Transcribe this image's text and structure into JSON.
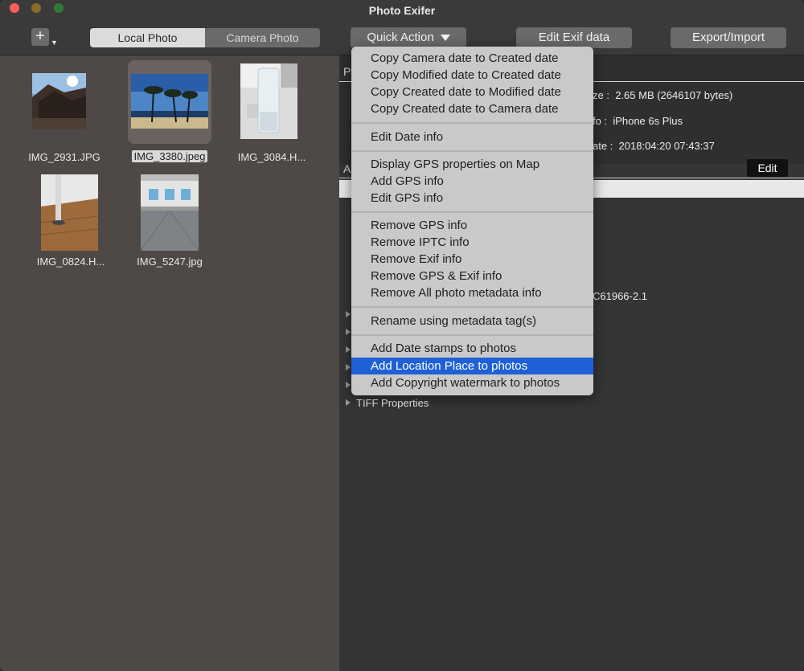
{
  "window": {
    "title": "Photo Exifer"
  },
  "toolbar": {
    "add_symbol": "+",
    "segments": [
      "Local Photo",
      "Camera Photo"
    ],
    "quick_action": "Quick Action",
    "edit_exif": "Edit Exif data",
    "export_import": "Export/Import"
  },
  "photos": [
    {
      "name": "IMG_2931.JPG"
    },
    {
      "name": "IMG_3380.jpeg",
      "selected": true
    },
    {
      "name": "IMG_3084.H..."
    },
    {
      "name": "IMG_0824.H..."
    },
    {
      "name": "IMG_5247.jpg"
    }
  ],
  "right": {
    "tab1_initial": "P",
    "tab2_initial": "A",
    "rows": [
      {
        "label": "ze :",
        "value": "2.65 MB (2646107 bytes)"
      },
      {
        "label": "fo :",
        "value": "iPhone 6s Plus"
      },
      {
        "label": "ate :",
        "value": "2018:04:20 07:43:37"
      }
    ],
    "edit_label": "Edit",
    "partial_value": "C61966-2.1",
    "tiff_label": "TIFF Properties"
  },
  "menu": {
    "groups": [
      [
        "Copy Camera date to Created date",
        "Copy Modified date to Created date",
        "Copy Created date to Modified date",
        "Copy Created date to Camera date"
      ],
      [
        "Edit Date info"
      ],
      [
        "Display GPS properties on Map",
        "Add GPS info",
        "Edit GPS  info"
      ],
      [
        "Remove GPS info",
        "Remove IPTC info",
        "Remove Exif info",
        "Remove GPS & Exif info",
        "Remove All photo metadata info"
      ],
      [
        "Rename using metadata tag(s)"
      ],
      [
        "Add Date stamps to photos",
        "Add Location Place to photos",
        "Add Copyright watermark to photos"
      ]
    ],
    "highlighted": "Add Location Place to photos"
  },
  "colors": {
    "highlight": "#1f60d6",
    "left_panel": "#4e4946",
    "menu_bg": "#c9c9c9"
  }
}
